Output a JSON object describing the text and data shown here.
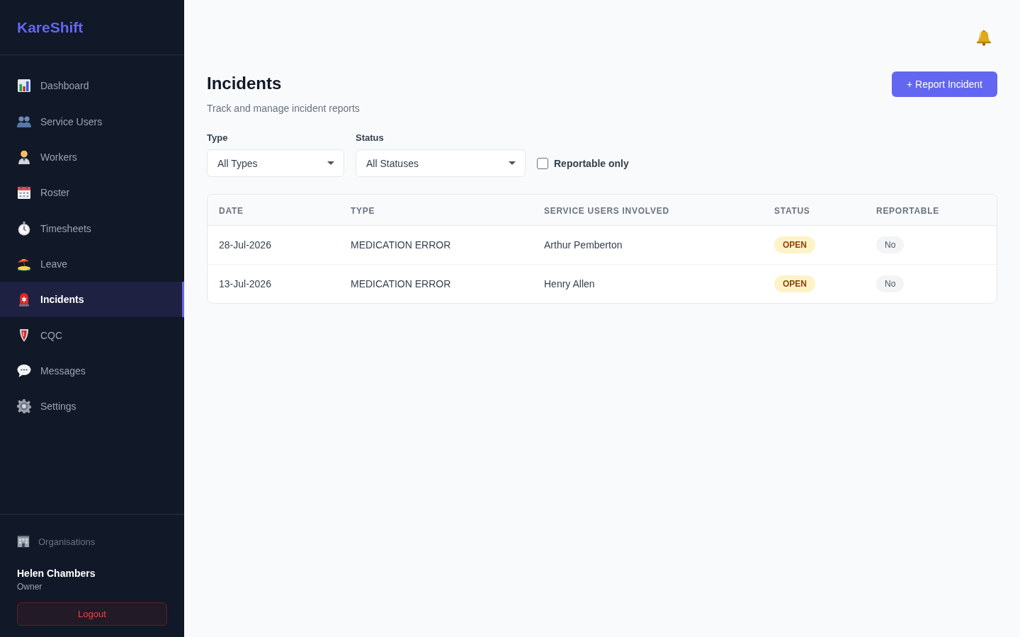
{
  "sidebar": {
    "logo": "KareShift",
    "nav": [
      {
        "label": "Dashboard",
        "selected": false
      },
      {
        "label": "Service Users",
        "selected": false
      },
      {
        "label": "Workers",
        "selected": false
      },
      {
        "label": "Roster",
        "selected": false
      },
      {
        "label": "Timesheets",
        "selected": false
      },
      {
        "label": "Leave",
        "selected": false
      },
      {
        "label": "Incidents",
        "selected": true
      },
      {
        "label": "CQC",
        "selected": false
      },
      {
        "label": "Messages",
        "selected": false
      },
      {
        "label": "Settings",
        "selected": false
      }
    ],
    "footer": {
      "organisations_link": "Organisations",
      "user": {
        "name": "Helen Chambers",
        "role": "Owner"
      },
      "logout_button": "Logout"
    }
  },
  "page": {
    "title": "Incidents",
    "subtitle": "Track and manage incident reports",
    "primary_button": "+ Report Incident"
  },
  "filters": {
    "type": {
      "label": "Type",
      "value": "All Types"
    },
    "status": {
      "label": "Status",
      "value": "All Statuses"
    },
    "reportable_only": {
      "label": "Reportable only",
      "checked": false
    }
  },
  "table": {
    "columns": [
      "DATE",
      "TYPE",
      "SERVICE USERS INVOLVED",
      "STATUS",
      "REPORTABLE"
    ],
    "rows": [
      {
        "date": "28-Jul-2026",
        "type": "MEDICATION ERROR",
        "service_users": "Arthur Pemberton",
        "status": "OPEN",
        "reportable": "No"
      },
      {
        "date": "13-Jul-2026",
        "type": "MEDICATION ERROR",
        "service_users": "Henry Allen",
        "status": "OPEN",
        "reportable": "No"
      }
    ]
  }
}
